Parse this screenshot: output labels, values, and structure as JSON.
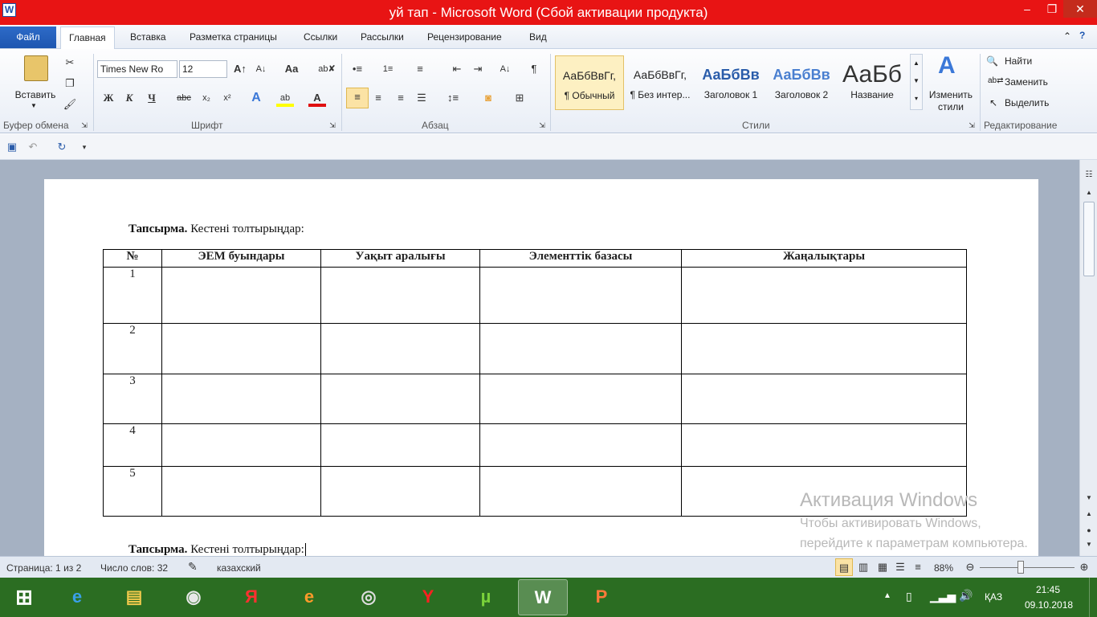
{
  "window": {
    "title": "уй тап  -  Microsoft Word (Сбой активации продукта)",
    "app_icon": "W"
  },
  "menu": {
    "file": "Файл",
    "tabs": [
      "Главная",
      "Вставка",
      "Разметка страницы",
      "Ссылки",
      "Рассылки",
      "Рецензирование",
      "Вид"
    ]
  },
  "ribbon": {
    "clipboard": {
      "paste": "Вставить",
      "label": "Буфер обмена"
    },
    "font": {
      "name": "Times New Ro",
      "size": "12",
      "label": "Шрифт",
      "bold": "Ж",
      "italic": "К",
      "underline": "Ч"
    },
    "paragraph": {
      "label": "Абзац"
    },
    "styles": {
      "label": "Стили",
      "items": [
        {
          "preview": "АаБбВвГг,",
          "name": "¶ Обычный"
        },
        {
          "preview": "АаБбВвГг,",
          "name": "¶ Без интер..."
        },
        {
          "preview": "АаБбВв",
          "name": "Заголовок 1"
        },
        {
          "preview": "АаБбВв",
          "name": "Заголовок 2"
        },
        {
          "preview": "АаБб",
          "name": "Название"
        }
      ],
      "change": "Изменить стили"
    },
    "editing": {
      "label": "Редактирование",
      "find": "Найти",
      "replace": "Заменить",
      "select": "Выделить"
    }
  },
  "document": {
    "task_bold": "Тапсырма.",
    "task_text": "Кестені толтырыңдар:",
    "table": {
      "headers": [
        "№",
        "ЭЕМ буындары",
        "Уақыт аралығы",
        "Элементтік базасы",
        "Жаңалықтары"
      ],
      "rows": [
        "1",
        "2",
        "3",
        "4",
        "5"
      ]
    },
    "task2_bold": "Тапсырма.",
    "task2_text": "Кестені толтырыңдар:"
  },
  "activation": {
    "title": "Активация Windows",
    "line1": "Чтобы активировать Windows,",
    "line2": "перейдите к параметрам компьютера."
  },
  "statusbar": {
    "page": "Страница: 1 из 2",
    "words": "Число слов: 32",
    "language": "казахский",
    "zoom": "88%"
  },
  "taskbar": {
    "language": "ҚАЗ",
    "time": "21:45",
    "date": "09.10.2018"
  }
}
